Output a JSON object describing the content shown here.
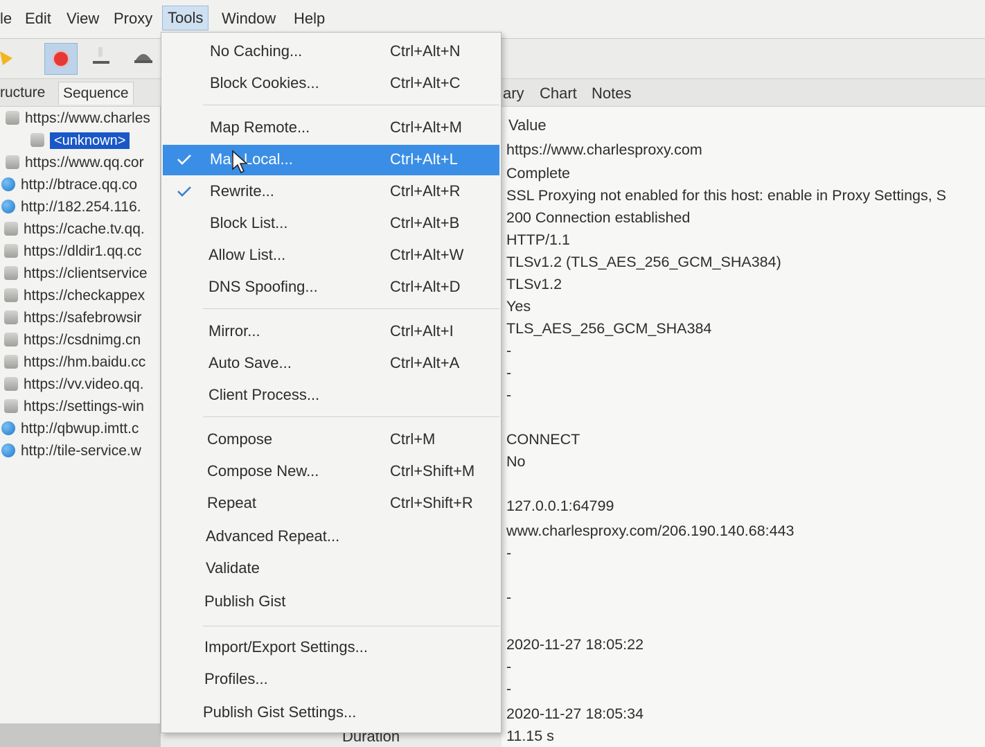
{
  "menubar": {
    "items": [
      "le",
      "Edit",
      "View",
      "Proxy",
      "Tools",
      "Window",
      "Help"
    ],
    "active": "Tools"
  },
  "toolbar": {
    "icons": [
      "pen-icon",
      "record-icon",
      "throttle-icon",
      "turtle-icon"
    ]
  },
  "left": {
    "tabs": [
      "ructure",
      "Sequence"
    ],
    "tree": [
      {
        "icon": "lock",
        "label": "https://www.charles"
      },
      {
        "icon": "lock",
        "label": "<unknown>",
        "selected": true
      },
      {
        "icon": "lock",
        "label": "https://www.qq.cor"
      },
      {
        "icon": "globe",
        "label": "http://btrace.qq.co"
      },
      {
        "icon": "globe",
        "label": "http://182.254.116."
      },
      {
        "icon": "lock",
        "label": "https://cache.tv.qq."
      },
      {
        "icon": "lock",
        "label": "https://dldir1.qq.cc"
      },
      {
        "icon": "lock",
        "label": "https://clientservice"
      },
      {
        "icon": "lock",
        "label": "https://checkappex"
      },
      {
        "icon": "lock",
        "label": "https://safebrowsir"
      },
      {
        "icon": "lock",
        "label": "https://csdnimg.cn"
      },
      {
        "icon": "lock",
        "label": "https://hm.baidu.cc"
      },
      {
        "icon": "lock",
        "label": "https://vv.video.qq."
      },
      {
        "icon": "lock",
        "label": "https://settings-win"
      },
      {
        "icon": "globe",
        "label": "http://qbwup.imtt.c"
      },
      {
        "icon": "globe",
        "label": "http://tile-service.w"
      }
    ]
  },
  "right": {
    "tabs": [
      "ary",
      "Chart",
      "Notes"
    ],
    "column_header": "Value",
    "values": [
      "https://www.charlesproxy.com",
      "Complete",
      "SSL Proxying not enabled for this host: enable in Proxy Settings, S",
      "200 Connection established",
      "HTTP/1.1",
      "TLSv1.2 (TLS_AES_256_GCM_SHA384)",
      "TLSv1.2",
      "Yes",
      "TLS_AES_256_GCM_SHA384",
      "-",
      "-",
      "-",
      "CONNECT",
      "No",
      "127.0.0.1:64799",
      "www.charlesproxy.com/206.190.140.68:443",
      "-",
      "-",
      "2020-11-27 18:05:22",
      "-",
      "-",
      "2020-11-27 18:05:34",
      "11.15 s"
    ]
  },
  "overview": {
    "duration_label": "Duration"
  },
  "tools_menu": {
    "items": [
      {
        "label": "No Caching...",
        "shortcut": "Ctrl+Alt+N"
      },
      {
        "label": "Block Cookies...",
        "shortcut": "Ctrl+Alt+C"
      },
      {
        "label": "Map Remote...",
        "shortcut": "Ctrl+Alt+M"
      },
      {
        "label": "Map Local...",
        "shortcut": "Ctrl+Alt+L",
        "checked": true,
        "highlighted": true
      },
      {
        "label": "Rewrite...",
        "shortcut": "Ctrl+Alt+R",
        "checked": true
      },
      {
        "label": "Block List...",
        "shortcut": "Ctrl+Alt+B"
      },
      {
        "label": "Allow List...",
        "shortcut": "Ctrl+Alt+W"
      },
      {
        "label": "DNS Spoofing...",
        "shortcut": "Ctrl+Alt+D"
      },
      {
        "label": "Mirror...",
        "shortcut": "Ctrl+Alt+I"
      },
      {
        "label": "Auto Save...",
        "shortcut": "Ctrl+Alt+A"
      },
      {
        "label": "Client Process...",
        "shortcut": ""
      },
      {
        "label": "Compose",
        "shortcut": "Ctrl+M"
      },
      {
        "label": "Compose New...",
        "shortcut": "Ctrl+Shift+M"
      },
      {
        "label": "Repeat",
        "shortcut": "Ctrl+Shift+R"
      },
      {
        "label": "Advanced Repeat...",
        "shortcut": ""
      },
      {
        "label": "Validate",
        "shortcut": ""
      },
      {
        "label": "Publish Gist",
        "shortcut": ""
      },
      {
        "label": "Import/Export Settings...",
        "shortcut": ""
      },
      {
        "label": "Profiles...",
        "shortcut": ""
      },
      {
        "label": "Publish Gist Settings...",
        "shortcut": ""
      }
    ]
  },
  "colors": {
    "highlight": "#3a8ee6",
    "selection_chip": "#1a57c7",
    "record_red": "#e53935"
  }
}
